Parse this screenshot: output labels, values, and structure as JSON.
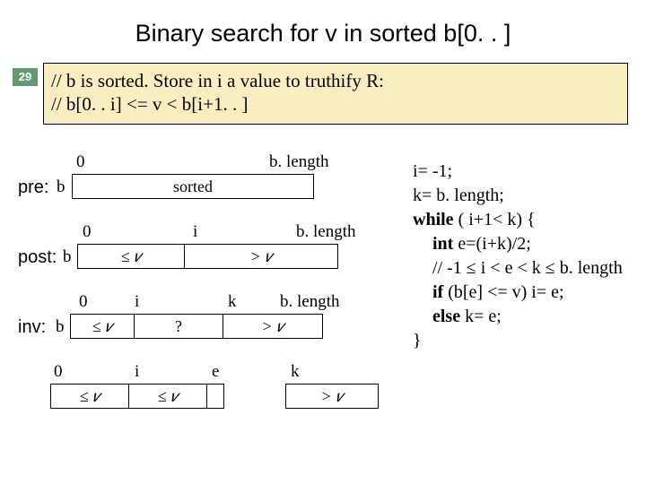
{
  "title": "Binary search for v in sorted b[0. . ]",
  "slidenum": "29",
  "comment": {
    "line1": "// b is sorted. Store in i  a value to truthify R:",
    "line2": "//          b[0. . i] <= v < b[i+1. . ]"
  },
  "diagrams": {
    "pre": {
      "label": "pre:",
      "b": "b",
      "zero": "0",
      "blen": "b. length",
      "mid": "sorted"
    },
    "post": {
      "label": "post:",
      "b": "b",
      "zero": "0",
      "i": "i",
      "blen": "b. length",
      "left": "≤ 𝑣",
      "right": "> 𝑣"
    },
    "inv": {
      "label": "inv:",
      "b": "b",
      "zero": "0",
      "i": "i",
      "k": "k",
      "blen": "b. length",
      "left": "≤ 𝑣",
      "mid": "?",
      "right": "> 𝑣"
    },
    "step": {
      "zero": "0",
      "i": "i",
      "e": "e",
      "k": "k",
      "left": "≤ 𝑣",
      "mid": "≤ 𝑣",
      "right": "> 𝑣"
    }
  },
  "code": {
    "l1": "i= -1;",
    "l2": "k= b. length;",
    "l3a": "while",
    "l3b": "  ( i+1< k) {",
    "l4a": "int",
    "l4b": " e=(i+k)/2;",
    "l5": "// -1 ≤ i < e < k ≤ b. length",
    "l6a": "if",
    "l6b": " (b[e] <= v)  i= e;",
    "l7a": "else",
    "l7b": " k= e;",
    "l8": "}"
  }
}
